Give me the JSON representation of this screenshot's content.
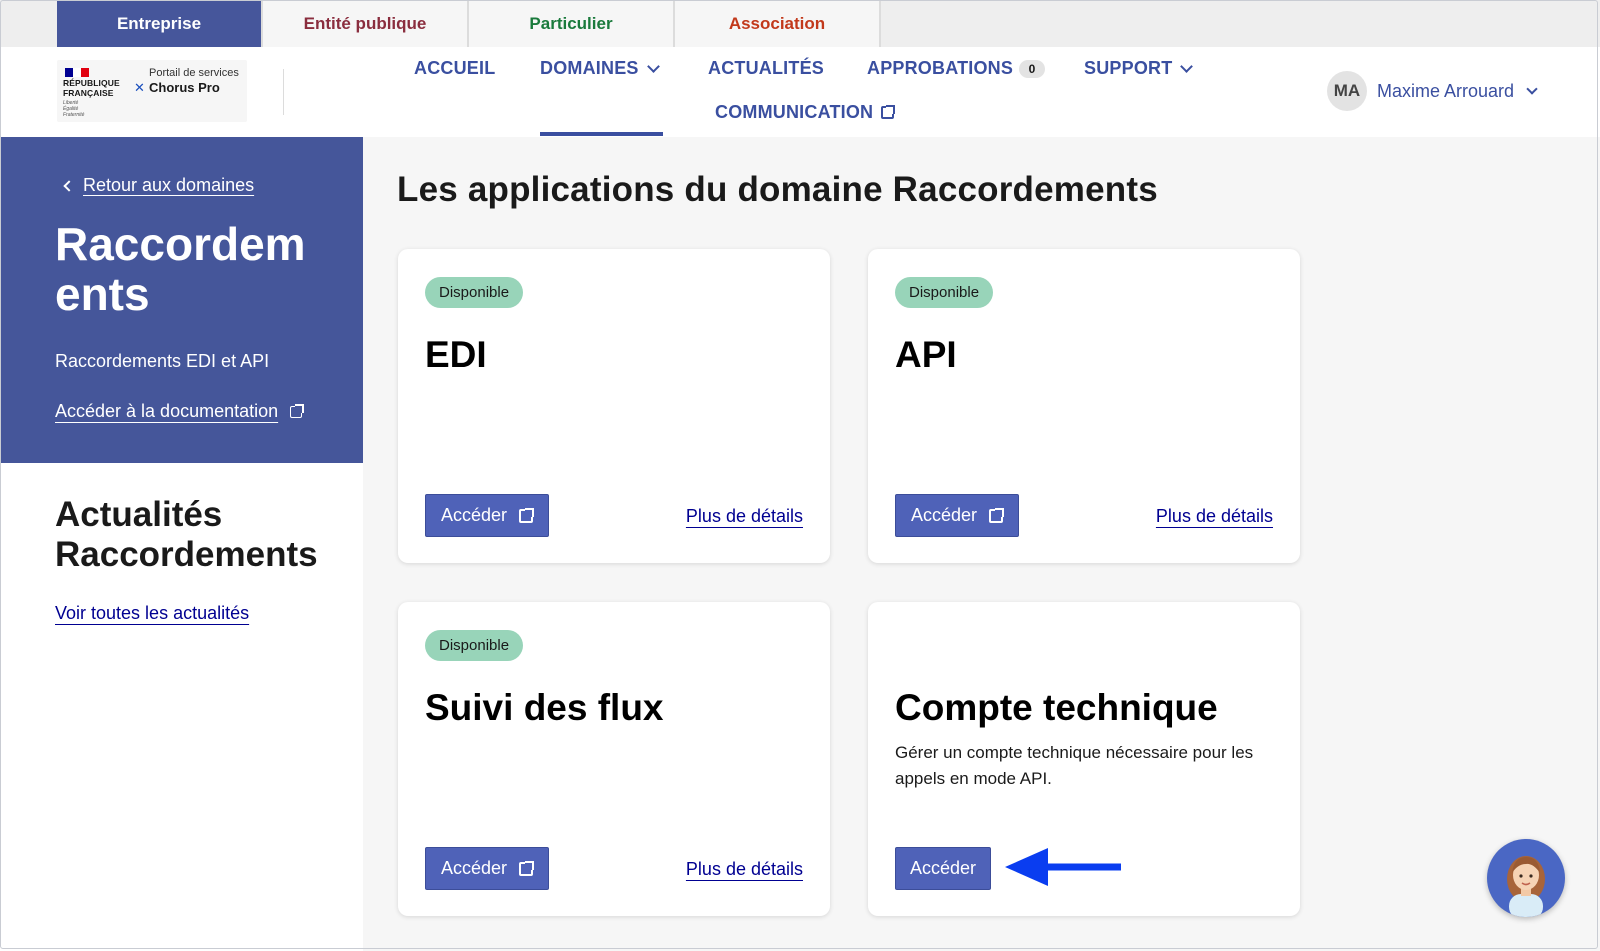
{
  "profile_tabs": [
    {
      "label": "Entreprise",
      "color": "#ffffff",
      "active": true
    },
    {
      "label": "Entité publique",
      "color": "#8a2d3e",
      "active": false
    },
    {
      "label": "Particulier",
      "color": "#1a7a3c",
      "active": false
    },
    {
      "label": "Association",
      "color": "#c2391b",
      "active": false
    }
  ],
  "logo": {
    "republic_line1": "RÉPUBLIQUE",
    "republic_line2": "FRANÇAISE",
    "motto": [
      "Liberté",
      "Égalité",
      "Fraternité"
    ],
    "portal_small": "Portail de services",
    "portal_name": "Chorus Pro"
  },
  "nav": {
    "accueil": "ACCUEIL",
    "domaines": "DOMAINES",
    "actualites": "ACTUALITÉS",
    "approbations": "APPROBATIONS",
    "approbations_count": "0",
    "support": "SUPPORT",
    "communication": "COMMUNICATION"
  },
  "user": {
    "initials": "MA",
    "name": "Maxime Arrouard"
  },
  "domain": {
    "back_label": "Retour aux domaines",
    "title": "Raccordements",
    "description": "Raccordements EDI et API",
    "doc_link": "Accéder à la documentation"
  },
  "news": {
    "title_line1": "Actualités",
    "title_line2": "Raccordements",
    "link": "Voir toutes les actualités"
  },
  "main": {
    "title": "Les applications du domaine Raccordements",
    "cards": [
      {
        "badge": "Disponible",
        "title": "EDI",
        "description": "",
        "button": "Accéder",
        "details": "Plus de détails"
      },
      {
        "badge": "Disponible",
        "title": "API",
        "description": "",
        "button": "Accéder",
        "details": "Plus de détails"
      },
      {
        "badge": "Disponible",
        "title": "Suivi des flux",
        "description": "",
        "button": "Accéder",
        "details": "Plus de détails"
      },
      {
        "badge": "",
        "title": "Compte technique",
        "description": "Gérer un compte technique nécessaire pour les appels en mode API.",
        "button": "Accéder",
        "details": ""
      }
    ]
  },
  "colors": {
    "primary": "#3a4fa0",
    "panel": "#45569a",
    "badge": "#98d4b9",
    "button": "#4f62b8",
    "arrow": "#0a3df0"
  }
}
